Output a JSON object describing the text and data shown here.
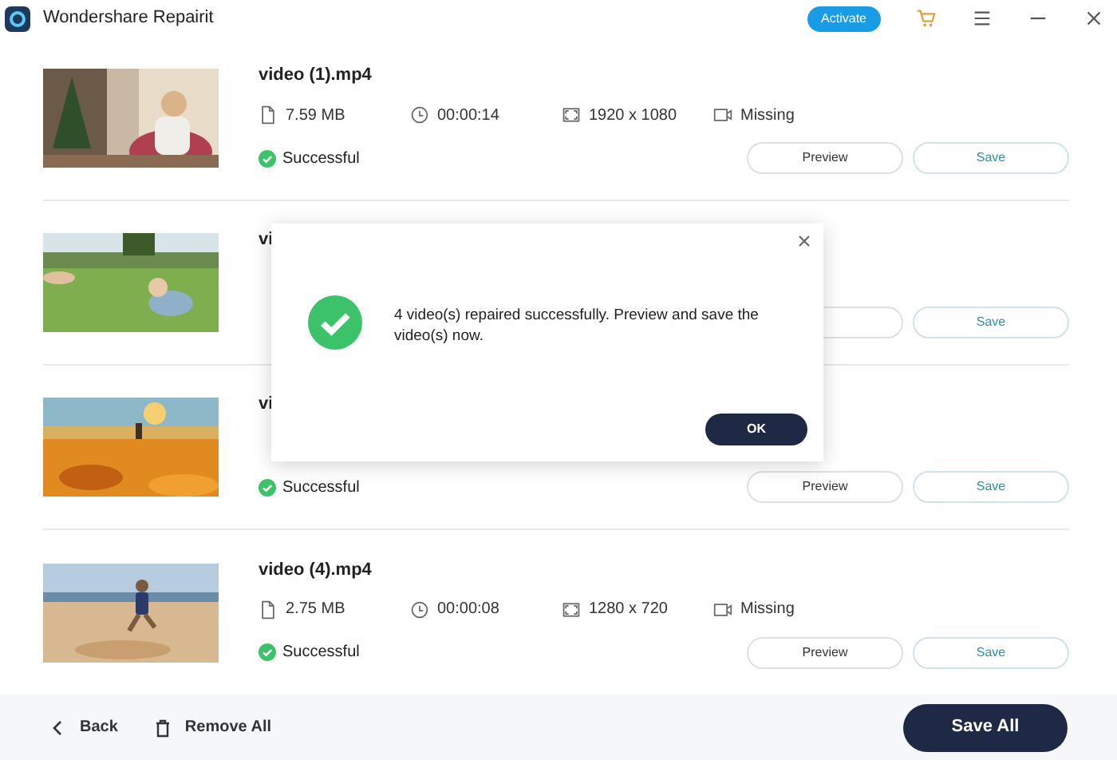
{
  "window": {
    "title": "Wondershare Repairit",
    "activate": "Activate"
  },
  "videos": [
    {
      "name": "video (1).mp4",
      "meta": [
        {
          "kind": "size",
          "text": "7.59  MB"
        },
        {
          "kind": "duration",
          "text": "00:00:14"
        },
        {
          "kind": "resolution",
          "text": "1920 x 1080"
        },
        {
          "kind": "audio",
          "text": "Missing"
        }
      ],
      "status": "Successful",
      "preview": "Preview",
      "save": "Save"
    },
    {
      "name": "vi",
      "save": "Save"
    },
    {
      "name": "vi",
      "status": "Successful",
      "preview": "Preview",
      "save": "Save"
    },
    {
      "name": "video (4).mp4",
      "meta": [
        {
          "kind": "size",
          "text": "2.75  MB"
        },
        {
          "kind": "duration",
          "text": "00:00:08"
        },
        {
          "kind": "resolution",
          "text": "1280 x 720"
        },
        {
          "kind": "audio",
          "text": "Missing"
        }
      ],
      "status": "Successful",
      "preview": "Preview",
      "save": "Save"
    }
  ],
  "dialog": {
    "message": "4 video(s) repaired successfully. Preview and save the video(s) now.",
    "ok": "OK"
  },
  "footer": {
    "back": "Back",
    "remove_all": "Remove All",
    "save_all": "Save All"
  }
}
